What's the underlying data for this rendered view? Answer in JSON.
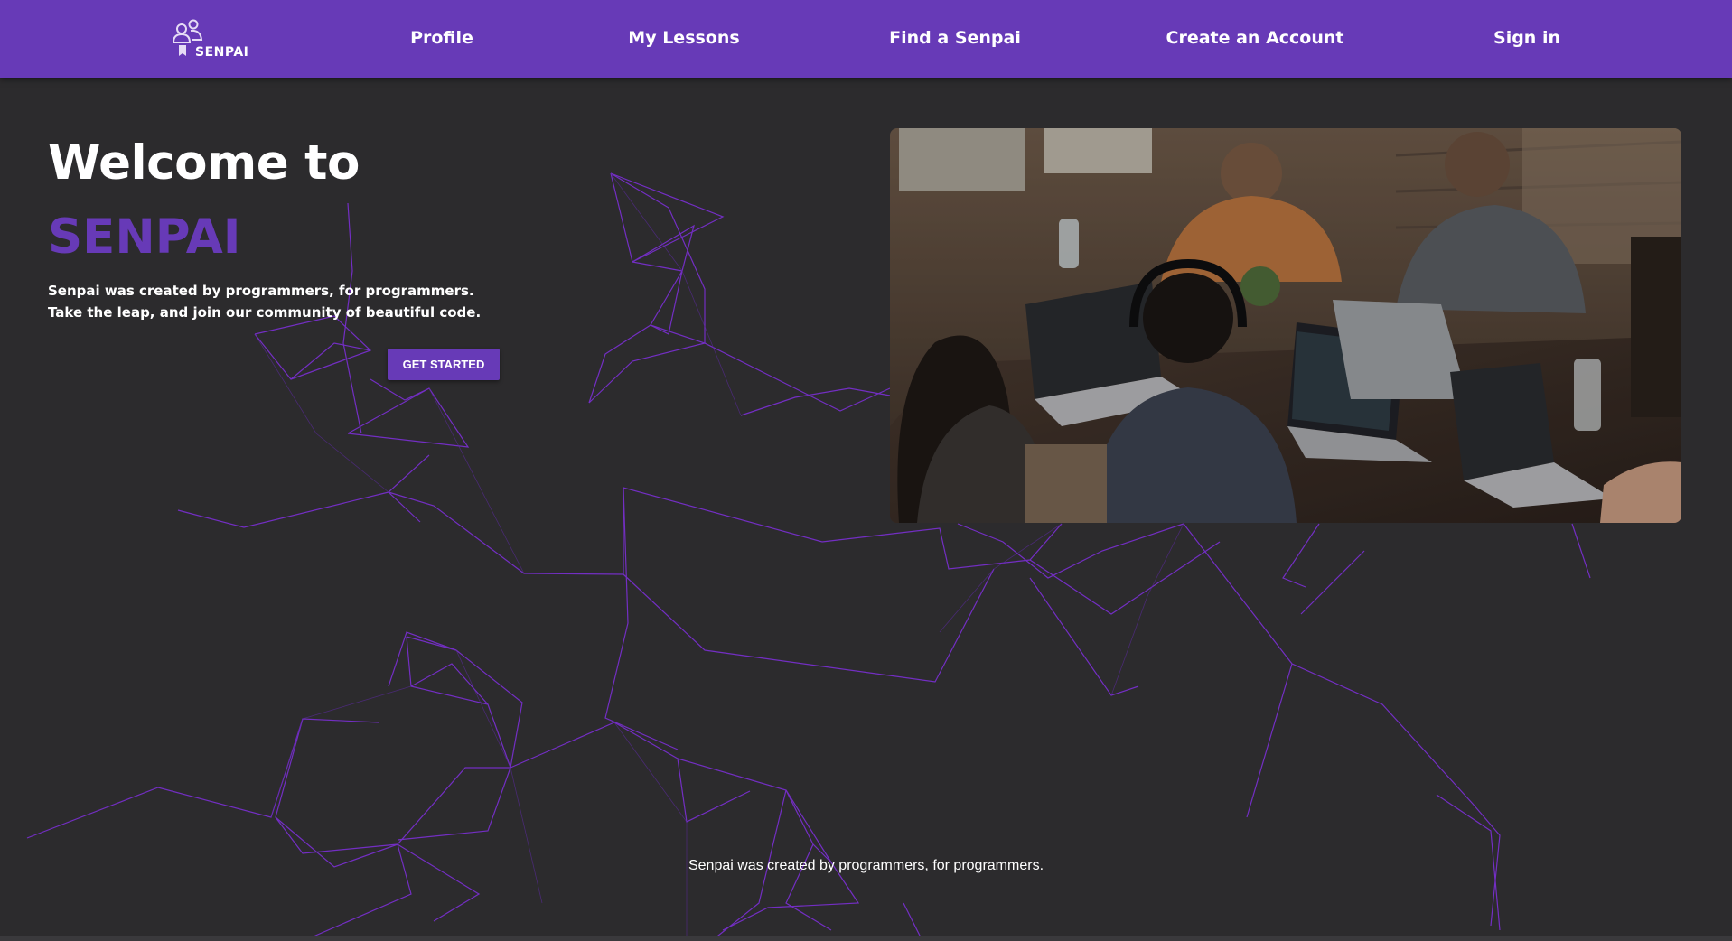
{
  "nav": {
    "brand": "SENPAI",
    "links": [
      "Profile",
      "My Lessons",
      "Find a Senpai",
      "Create an Account",
      "Sign in"
    ]
  },
  "hero": {
    "title": "Welcome to",
    "brand": "SENPAI",
    "tagline": [
      "Senpai was created by programmers, for programmers.",
      "Take the leap, and join our community of beautiful code."
    ],
    "cta_label": "GET STARTED"
  },
  "footer": {
    "text": "Senpai was created by programmers, for programmers."
  },
  "colors": {
    "accent": "#673ab7",
    "background": "#2c2b2d",
    "text": "#ffffff"
  }
}
